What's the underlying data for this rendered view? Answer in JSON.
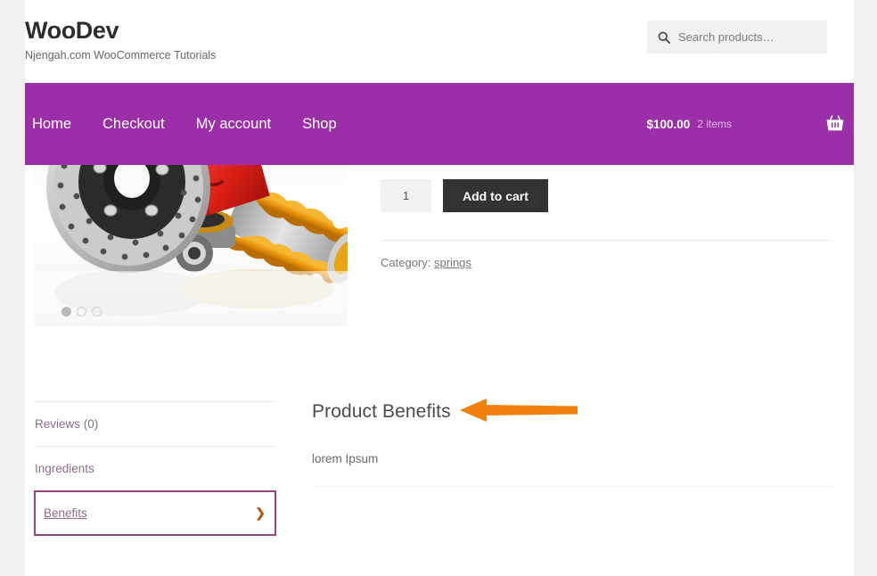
{
  "header": {
    "site_title": "WooDev",
    "tagline": "Njengah.com WooCommerce Tutorials",
    "search": {
      "placeholder": "Search products…",
      "value": "",
      "icon": "search-icon"
    }
  },
  "nav": {
    "background_color": "#9b2fa8",
    "items": [
      {
        "label": "Home"
      },
      {
        "label": "Checkout"
      },
      {
        "label": "My account"
      },
      {
        "label": "Shop"
      }
    ],
    "cart": {
      "total": "$100.00",
      "count": "2 items",
      "icon": "shopping-basket-icon"
    }
  },
  "product": {
    "gallery": {
      "image_alt": "car-brake-disc-and-coil-spring-suspension",
      "dots": [
        {
          "state": "active"
        },
        {
          "state": "inactive"
        },
        {
          "state": "inactive"
        }
      ]
    },
    "quantity": {
      "value": "1"
    },
    "add_to_cart_label": "Add to cart",
    "meta": {
      "category_label": "Category:",
      "category_value": "springs"
    }
  },
  "tabs": {
    "items": [
      {
        "label": "Reviews (0)",
        "active": false
      },
      {
        "label": "Ingredients",
        "active": false
      },
      {
        "label": "Benefits",
        "active": true,
        "chevron": "chevron-right-icon"
      }
    ],
    "active_border_color": "#95467f",
    "panel": {
      "title": "Product Benefits",
      "body": "lorem Ipsum"
    }
  },
  "annotation": {
    "type": "arrow-left",
    "color": "#f2800d",
    "points_to": "Product Benefits"
  }
}
